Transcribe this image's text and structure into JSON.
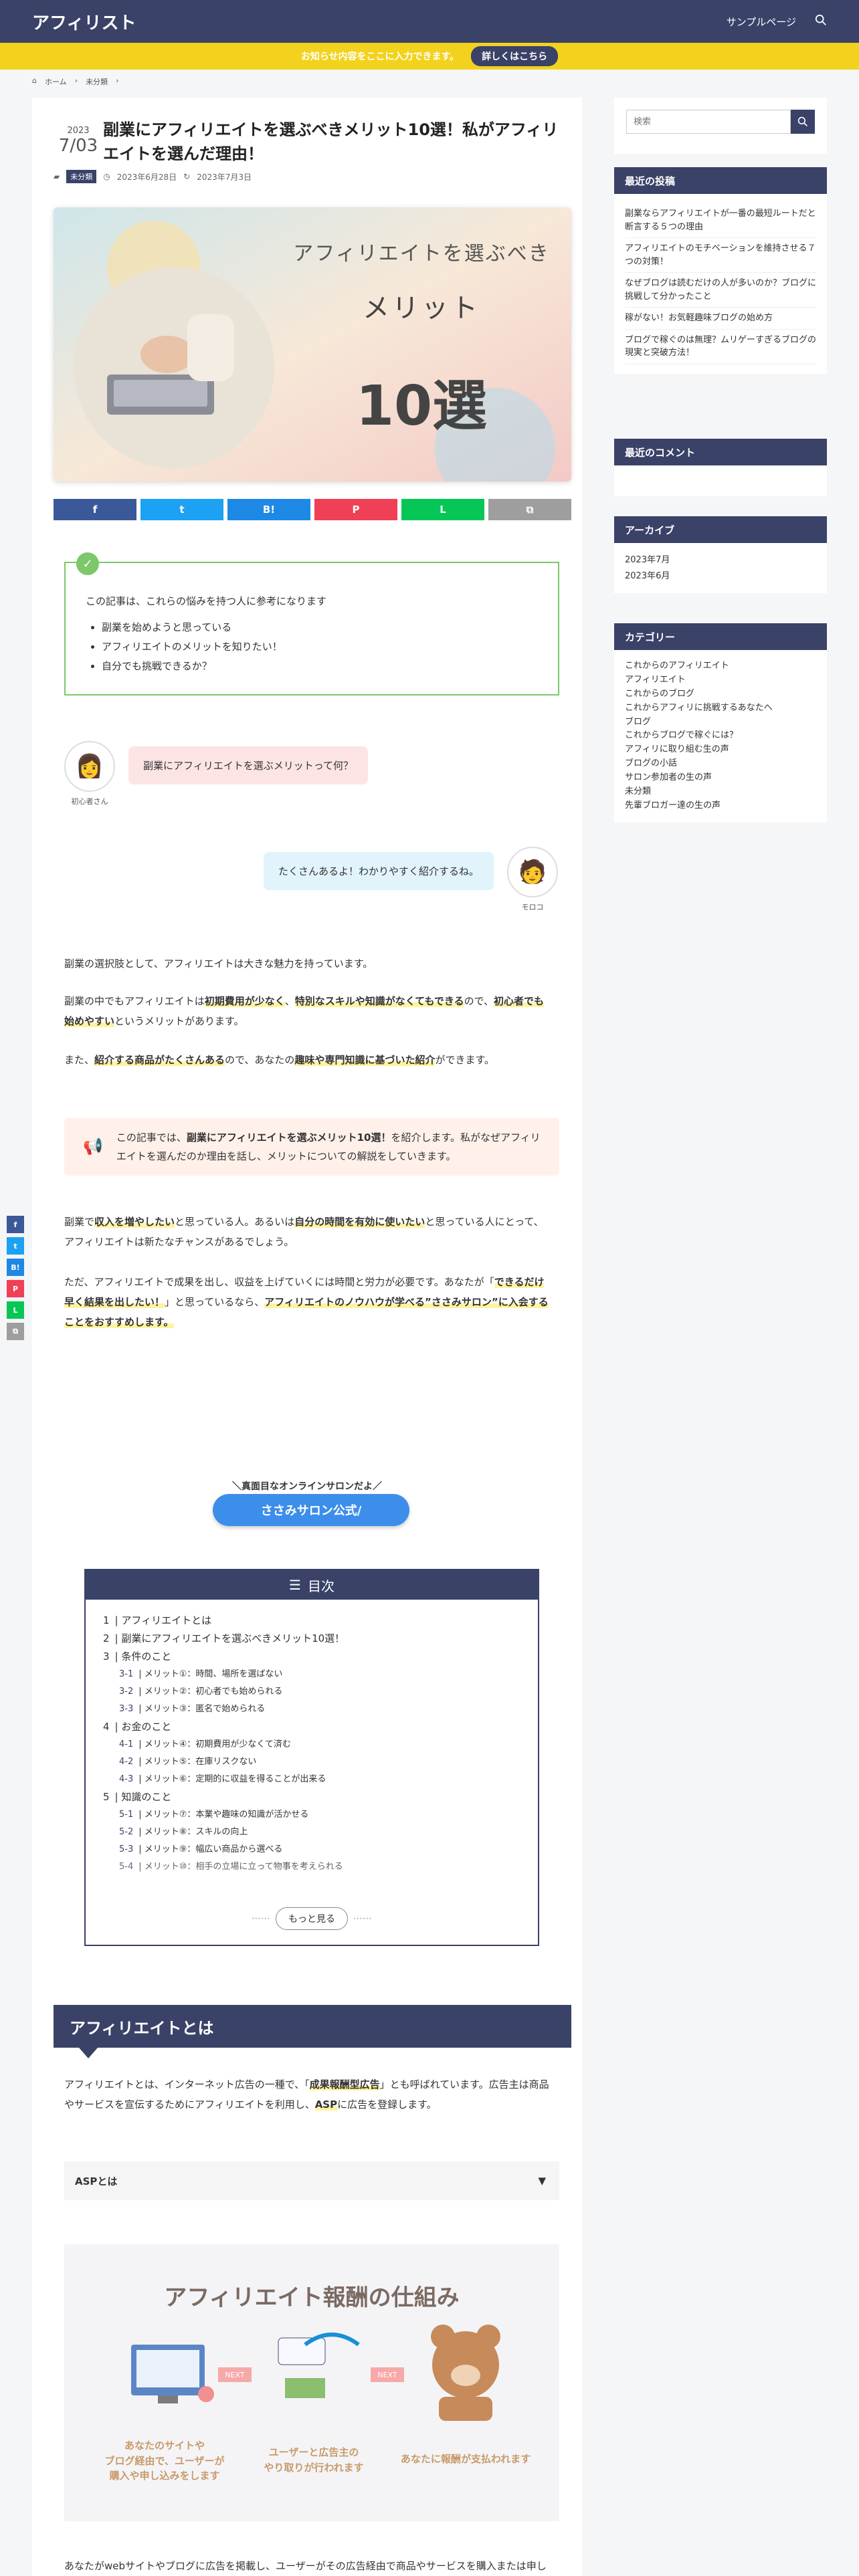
{
  "header": {
    "logo": "アフィリスト",
    "nav_sample": "サンプルページ"
  },
  "info_bar": {
    "text": "お知らせ内容をここに入力できます。",
    "button": "詳しくはこちら"
  },
  "breadcrumb": {
    "home": "ホーム",
    "category": "未分類"
  },
  "post": {
    "year": "2023",
    "day": "7/03",
    "title": "副業にアフィリエイトを選ぶべきメリット10選！私がアフィリエイトを選んだ理由！",
    "category": "未分類",
    "published": "2023年6月28日",
    "updated": "2023年7月3日",
    "eyecatch_line1": "アフィリエイトを選ぶべき",
    "eyecatch_line2": "メリット",
    "eyecatch_line3": "10選"
  },
  "share": {
    "buttons": [
      {
        "label": "f",
        "color": "#3b5998"
      },
      {
        "label": "t",
        "color": "#1da1f2"
      },
      {
        "label": "B!",
        "color": "#1e88e5"
      },
      {
        "label": "P",
        "color": "#ef4056"
      },
      {
        "label": "L",
        "color": "#06c755"
      },
      {
        "label": "⧉",
        "color": "#9e9e9e"
      }
    ]
  },
  "point_box": {
    "intro": "この記事は、これらの悩みを持つ人に参考になります",
    "items": [
      "副業を始めようと思っている",
      "アフィリエイトのメリットを知りたい！",
      "自分でも挑戦できるか？"
    ]
  },
  "speech": {
    "q_name": "初心者さん",
    "q_text": "副業にアフィリエイトを選ぶメリットって何？",
    "a_name": "モロコ",
    "a_text": "たくさんあるよ！わかりやすく紹介するね。"
  },
  "body": {
    "p1": "副業の選択肢として、アフィリエイトは大きな魅力を持っています。",
    "p2_a": "副業の中でもアフィリエイトは",
    "p2_b": "初期費用が少なく",
    "p2_c": "、",
    "p2_d": "特別なスキルや知識がなくてもできる",
    "p2_e": "ので、",
    "p2_f": "初心者でも始めやすい",
    "p2_g": "というメリットがあります。",
    "p3_a": "また、",
    "p3_b": "紹介する商品がたくさんある",
    "p3_c": "ので、あなたの",
    "p3_d": "趣味や専門知識に基づいた紹介",
    "p3_e": "ができます。",
    "tip_a": "この記事では、",
    "tip_b": "副業にアフィリエイトを選ぶメリット10選！",
    "tip_c": "を紹介します。私がなぜアフィリエイトを選んだのか理由を話し、メリットについての解説をしていきます。",
    "p4_a": "副業で",
    "p4_b": "収入を増やしたい",
    "p4_c": "と思っている人。あるいは",
    "p4_d": "自分の時間を有効に使いたい",
    "p4_e": "と思っている人にとって、アフィリエイトは新たなチャンスがあるでしょう。",
    "p5_a": "ただ、アフィリエイトで成果を出し、収益を上げていくには時間と労力が必要です。あなたが「",
    "p5_b": "できるだけ早く結果を出したい！",
    "p5_c": "」と思っているなら、",
    "p5_d": "アフィリエイトのノウハウが学べる”ささみサロン”に入会することをおすすめします。",
    "cta_caption": "＼真面目なオンラインサロンだよ／",
    "cta_button": "ささみサロン公式/"
  },
  "toc": {
    "title": "目次",
    "more": "もっと見る",
    "sections": [
      {
        "num": "1",
        "label": "アフィリエイトとは",
        "subs": []
      },
      {
        "num": "2",
        "label": "副業にアフィリエイトを選ぶべきメリット10選！",
        "subs": []
      },
      {
        "num": "3",
        "label": "条件のこと",
        "subs": [
          {
            "num": "3-1",
            "label": "メリット①：時間、場所を選ばない"
          },
          {
            "num": "3-2",
            "label": "メリット②：初心者でも始められる"
          },
          {
            "num": "3-3",
            "label": "メリット③：匿名で始められる"
          }
        ]
      },
      {
        "num": "4",
        "label": "お金のこと",
        "subs": [
          {
            "num": "4-1",
            "label": "メリット④：初期費用が少なくて済む"
          },
          {
            "num": "4-2",
            "label": "メリット⑤：在庫リスクない"
          },
          {
            "num": "4-3",
            "label": "メリット⑥：定期的に収益を得ることが出来る"
          }
        ]
      },
      {
        "num": "5",
        "label": "知識のこと",
        "subs": [
          {
            "num": "5-1",
            "label": "メリット⑦：本業や趣味の知識が活かせる"
          },
          {
            "num": "5-2",
            "label": "メリット⑧：スキルの向上"
          },
          {
            "num": "5-3",
            "label": "メリット⑨：幅広い商品から選べる"
          },
          {
            "num": "5-4",
            "label": "メリット⑩：相手の立場に立って物事を考えられる"
          }
        ]
      }
    ]
  },
  "section1": {
    "h2": "アフィリエイトとは",
    "p1_a": "アフィリエイトとは、インターネット広告の一種で、「",
    "p1_b": "成果報酬型広告",
    "p1_c": "」とも呼ばれています。広告主は商品やサービスを宣伝するためにアフィリエイトを利用し、",
    "p1_d": "ASP",
    "p1_e": "に広告を登録します。",
    "accordion": "ASPとは",
    "diagram_title": "アフィリエイト報酬の仕組み",
    "diagram_step1": "あなたのサイトや\nブログ経由で、ユーザーが\n購入や申し込みをします",
    "diagram_step2": "ユーザーと広告主の\nやり取りが行われます",
    "diagram_step3": "あなたに報酬が支払われます",
    "diagram_next": "NEXT",
    "p2": "あなたがwebサイトやブログに広告を掲載し、ユーザーがその広告経由で商品やサービスを購入または申し込むと、あなたに報酬が支払われます。"
  },
  "sidebar": {
    "search_placeholder": "検索",
    "recent_title": "最近の投稿",
    "recent": [
      "副業ならアフィリエイトが一番の最短ルートだと断言する５つの理由",
      "アフィリエイトのモチベーションを維持させる７つの対策！",
      "なぜブログは読むだけの人が多いのか？ブログに挑戦して分かったこと",
      "稼がない！お気軽趣味ブログの始め方",
      "ブログで稼ぐのは無理？ムリゲーすぎるブログの現実と突破方法！"
    ],
    "comments_title": "最近のコメント",
    "archive_title": "アーカイブ",
    "archives": [
      "2023年7月",
      "2023年6月"
    ],
    "category_title": "カテゴリー",
    "categories": [
      "これからのアフィリエイト",
      "アフィリエイト",
      "これからのブログ",
      "これからアフィリに挑戦するあなたへ",
      "ブログ",
      "これからブログで稼ぐには？",
      "アフィリに取り組む生の声",
      "ブログの小話",
      "サロン参加者の生の声",
      "未分類",
      "先輩ブロガー達の生の声"
    ]
  },
  "float_share": [
    "f",
    "t",
    "B!",
    "P",
    "L",
    "⧉"
  ]
}
